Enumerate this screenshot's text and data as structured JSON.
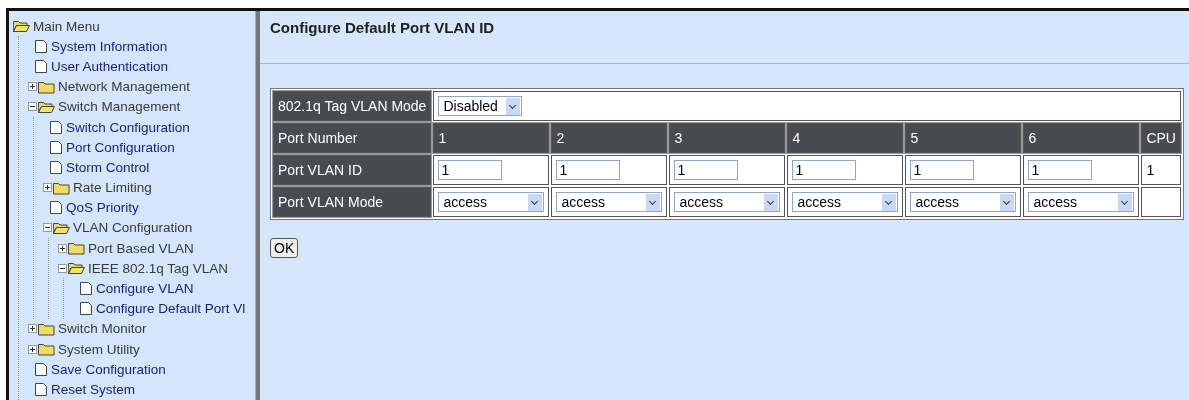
{
  "menu": {
    "label": "Main Menu",
    "kind": "folder",
    "expanded": true,
    "children": [
      {
        "label": "System Information",
        "kind": "page"
      },
      {
        "label": "User Authentication",
        "kind": "page"
      },
      {
        "label": "Network Management",
        "kind": "folder",
        "expanded": false
      },
      {
        "label": "Switch Management",
        "kind": "folder",
        "expanded": true,
        "children": [
          {
            "label": "Switch Configuration",
            "kind": "page"
          },
          {
            "label": "Port Configuration",
            "kind": "page"
          },
          {
            "label": "Storm Control",
            "kind": "page"
          },
          {
            "label": "Rate Limiting",
            "kind": "folder",
            "expanded": false
          },
          {
            "label": "QoS Priority",
            "kind": "page"
          },
          {
            "label": "VLAN Configuration",
            "kind": "folder",
            "expanded": true,
            "children": [
              {
                "label": "Port Based VLAN",
                "kind": "folder",
                "expanded": false
              },
              {
                "label": "IEEE 802.1q Tag VLAN",
                "kind": "folder",
                "expanded": true,
                "children": [
                  {
                    "label": "Configure VLAN",
                    "kind": "page"
                  },
                  {
                    "label": "Configure Default Port Vl",
                    "kind": "page"
                  }
                ]
              }
            ]
          }
        ]
      },
      {
        "label": "Switch Monitor",
        "kind": "folder",
        "expanded": false
      },
      {
        "label": "System Utility",
        "kind": "folder",
        "expanded": false
      },
      {
        "label": "Save Configuration",
        "kind": "page"
      },
      {
        "label": "Reset System",
        "kind": "page"
      }
    ]
  },
  "page_title": "Configure Default Port VLAN ID",
  "tag_vlan_mode": {
    "label": "802.1q Tag VLAN Mode",
    "value": "Disabled"
  },
  "table": {
    "port_number_label": "Port Number",
    "pvid_label": "Port VLAN ID",
    "mode_label": "Port VLAN Mode",
    "ports": [
      {
        "number": "1",
        "pvid": "1",
        "mode": "access"
      },
      {
        "number": "2",
        "pvid": "1",
        "mode": "access"
      },
      {
        "number": "3",
        "pvid": "1",
        "mode": "access"
      },
      {
        "number": "4",
        "pvid": "1",
        "mode": "access"
      },
      {
        "number": "5",
        "pvid": "1",
        "mode": "access"
      },
      {
        "number": "6",
        "pvid": "1",
        "mode": "access"
      }
    ],
    "cpu": {
      "number": "CPU",
      "pvid": "1"
    }
  },
  "ok_button": "OK"
}
